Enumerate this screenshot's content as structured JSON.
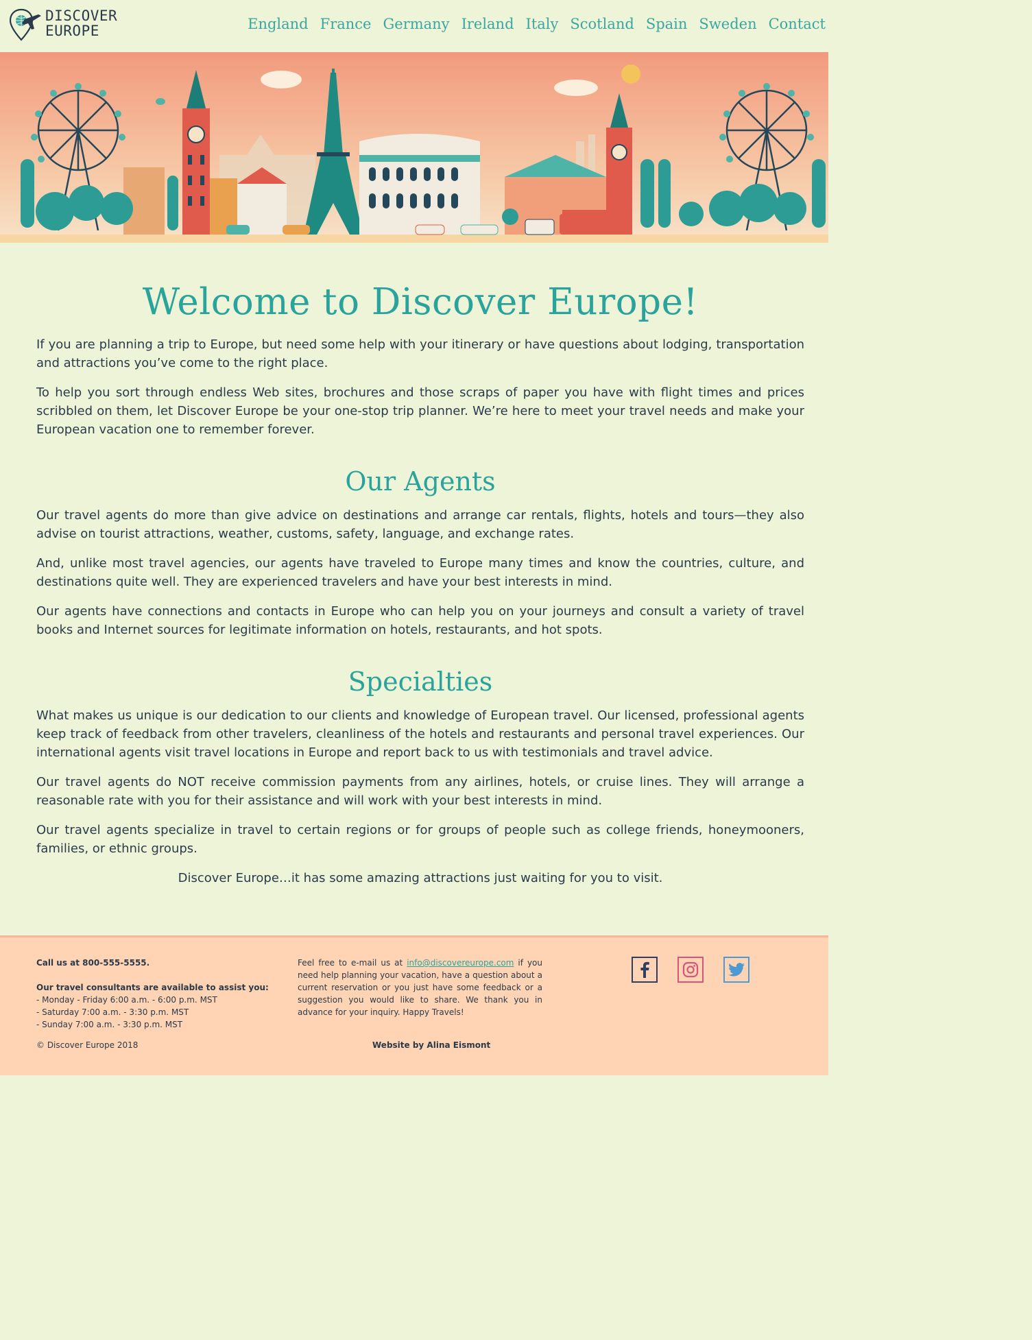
{
  "brand": {
    "line1": "DISCOVER",
    "line2": "EUROPE"
  },
  "nav": [
    "England",
    "France",
    "Germany",
    "Ireland",
    "Italy",
    "Scotland",
    "Spain",
    "Sweden",
    "Contact"
  ],
  "main": {
    "title": "Welcome to Discover Europe!",
    "intro": [
      "If you are planning a trip to Europe, but need some help with your itinerary or have questions about lodging, transportation and attractions you’ve come to the right place.",
      "To help you sort through endless Web sites, brochures and those scraps of paper you have with flight times and prices scribbled on them, let Discover Europe be your one-stop trip planner. We’re here to meet your travel needs and make your European vacation one to remember forever."
    ],
    "agents_heading": "Our Agents",
    "agents": [
      "Our travel agents do more than give advice on destinations and arrange car rentals, flights, hotels and tours—they also advise on tourist attractions, weather, customs, safety, language, and exchange rates.",
      "And, unlike most travel agencies, our agents have traveled to Europe many times and know the countries, culture, and destinations quite well. They are experienced travelers and have your best interests in mind.",
      "Our agents have connections and contacts in Europe who can help you on your journeys and consult a variety of travel books and Internet sources for legitimate information on hotels, restaurants, and hot spots."
    ],
    "specialties_heading": "Specialties",
    "specialties": [
      "What makes us unique is our dedication to our clients and knowledge of European travel. Our licensed, professional agents keep track of feedback from other travelers, cleanliness of the hotels and restaurants and personal travel experiences. Our international agents visit travel locations in Europe and report back to us with testimonials and travel advice.",
      "Our travel agents do NOT receive commission payments from any airlines, hotels, or cruise lines. They will arrange a reasonable rate with you for their assistance and will work with your best interests in mind.",
      "Our travel agents specialize in travel to certain regions or for groups of people such as college friends, honeymooners, families, or ethnic groups."
    ],
    "closing": "Discover Europe…it has some amazing attractions just waiting for you to visit."
  },
  "footer": {
    "phone": "Call us at 800-555-5555.",
    "hours_heading": "Our travel consultants are available to assist you:",
    "hours": [
      "- Monday - Friday 6:00 a.m. - 6:00 p.m. MST",
      "- Saturday 7:00 a.m. - 3:30 p.m. MST",
      "- Sunday 7:00 a.m. - 3:30 p.m. MST"
    ],
    "email_before": "Feel free to e-mail us at ",
    "email": "info@discovereurope.com",
    "email_after": " if you need help planning your vacation, have a question about a current reservation or you just have some feedback or a suggestion you would like to share. We thank you in advance for your inquiry. Happy Travels!",
    "copyright": "© Discover Europe 2018",
    "credit": "Website by Alina Eismont",
    "social": [
      {
        "icon": "facebook-icon",
        "color": "#2f3f62"
      },
      {
        "icon": "instagram-icon",
        "color": "#d4577b"
      },
      {
        "icon": "twitter-icon",
        "color": "#4d9ad3"
      }
    ]
  },
  "colors": {
    "background": "#eef4d8",
    "accent": "#2aa39c",
    "footer": "#fed4b4",
    "text": "#2b3a4a"
  }
}
